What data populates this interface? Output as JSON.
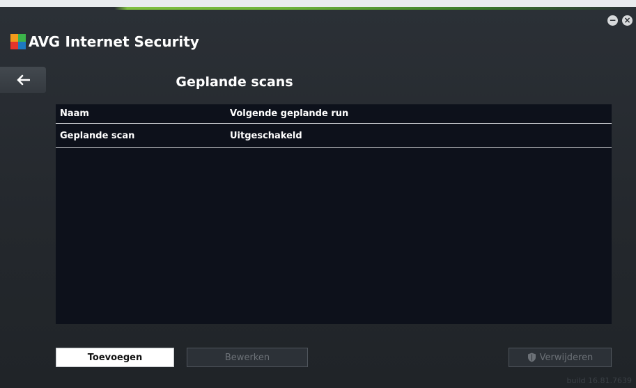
{
  "window": {
    "brand_avg": "AVG",
    "brand_rest": "Internet Security",
    "minimize_symbol": "−",
    "close_symbol": "×"
  },
  "nav": {
    "back_icon": "arrow-left-icon"
  },
  "page": {
    "title": "Geplande scans"
  },
  "table": {
    "columns": [
      "Naam",
      "Volgende geplande run"
    ],
    "rows": [
      [
        "Geplande scan",
        "Uitgeschakeld"
      ]
    ]
  },
  "buttons": {
    "add_label": "Toevoegen",
    "edit_label": "Bewerken",
    "remove_label": "Verwijderen",
    "remove_icon": "shield-icon"
  },
  "footer": {
    "build": "build 16.81.7639"
  },
  "colors": {
    "background": "#24282d",
    "accent_green": "#7fbf3f",
    "table_bg": "#0d111b"
  }
}
